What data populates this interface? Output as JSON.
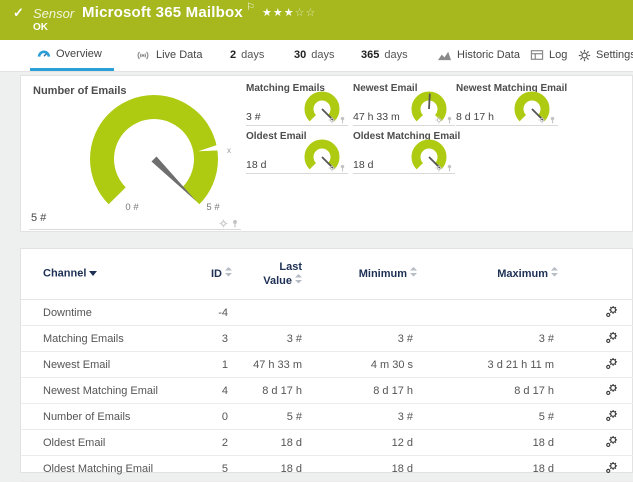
{
  "header": {
    "kind_label": "Sensor",
    "title": "Microsoft 365 Mailbox",
    "status": "OK",
    "stars_filled": "★★★",
    "stars_empty": "☆☆",
    "rating": {
      "filled": 3,
      "total": 5
    }
  },
  "icons": {
    "check": "✓",
    "flag": "⚐",
    "marker_x": "x"
  },
  "tabs": [
    {
      "label": "Overview",
      "icon": "gauge-icon",
      "active": true
    },
    {
      "label": "Live Data",
      "icon": "live-signal-icon"
    },
    {
      "num": "2",
      "unit": "days"
    },
    {
      "num": "30",
      "unit": "days"
    },
    {
      "num": "365",
      "unit": "days"
    },
    {
      "label": "Historic Data",
      "icon": "area-chart-icon"
    },
    {
      "label": "Log",
      "icon": "log-table-icon"
    },
    {
      "label": "Settings",
      "icon": "gear-icon"
    }
  ],
  "overview": {
    "main": {
      "title": "Number of Emails",
      "value": "5 #",
      "scale_min": "0 #",
      "scale_max": "5 #",
      "needle_position": "max"
    },
    "tiles": [
      {
        "title": "Matching Emails",
        "value": "3 #",
        "needle_position": "max"
      },
      {
        "title": "Newest Email",
        "value": "47 h 33 m",
        "needle_position": "mid"
      },
      {
        "title": "Newest Matching Email",
        "value": "8 d 17 h",
        "needle_position": "max"
      },
      {
        "title": "Oldest Email",
        "value": "18 d",
        "needle_position": "max"
      },
      {
        "title": "Oldest Matching Email",
        "value": "18 d",
        "needle_position": "max"
      }
    ]
  },
  "table": {
    "columns": {
      "channel": "Channel",
      "id": "ID",
      "last1": "Last",
      "last2": "Value",
      "min": "Minimum",
      "max": "Maximum"
    },
    "rows": [
      {
        "channel": "Downtime",
        "id": "-4",
        "last": "",
        "min": "",
        "max": ""
      },
      {
        "channel": "Matching Emails",
        "id": "3",
        "last": "3 #",
        "min": "3 #",
        "max": "3 #"
      },
      {
        "channel": "Newest Email",
        "id": "1",
        "last": "47 h 33 m",
        "min": "4 m 30 s",
        "max": "3 d 21 h 11 m"
      },
      {
        "channel": "Newest Matching Email",
        "id": "4",
        "last": "8 d 17 h",
        "min": "8 d 17 h",
        "max": "8 d 17 h"
      },
      {
        "channel": "Number of Emails",
        "id": "0",
        "last": "5 #",
        "min": "3 #",
        "max": "5 #"
      },
      {
        "channel": "Oldest Email",
        "id": "2",
        "last": "18 d",
        "min": "12 d",
        "max": "18 d"
      },
      {
        "channel": "Oldest Matching Email",
        "id": "5",
        "last": "18 d",
        "min": "18 d",
        "max": "18 d"
      }
    ]
  },
  "colors": {
    "status_up_green": "#a6b81e",
    "gauge_green": "#aeca11",
    "accent_blue": "#2b9fd8",
    "table_header_navy": "#1d3054"
  }
}
